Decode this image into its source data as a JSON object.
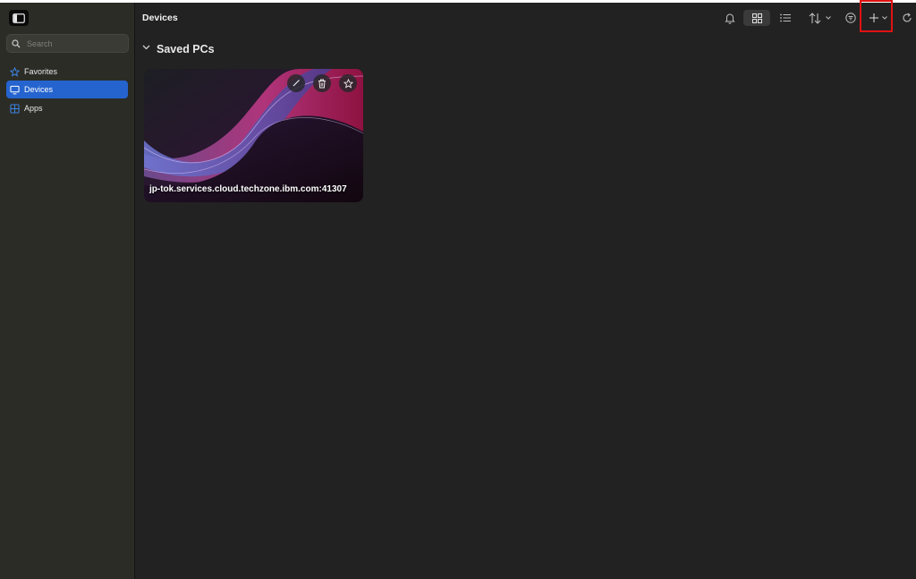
{
  "sidebar": {
    "search_placeholder": "Search",
    "items": [
      {
        "label": "Favorites",
        "icon": "star-icon"
      },
      {
        "label": "Devices",
        "icon": "monitor-icon",
        "active": true
      },
      {
        "label": "Apps",
        "icon": "apps-grid-icon"
      }
    ]
  },
  "header": {
    "title": "Devices",
    "toolbar": [
      "bell-icon",
      "grid-view-icon",
      "list-view-icon",
      "sort-icon",
      "filter-icon",
      "add-icon",
      "refresh-icon"
    ]
  },
  "section": {
    "title": "Saved PCs"
  },
  "devices": [
    {
      "name": "jp-tok.services.cloud.techzone.ibm.com:41307",
      "actions": [
        "edit-icon",
        "trash-icon",
        "favorite-star-icon"
      ]
    }
  ],
  "colors": {
    "accent": "#2564cf",
    "highlight": "#e01212",
    "sidebar_bg": "#2c2c27",
    "main_bg": "#222222"
  }
}
